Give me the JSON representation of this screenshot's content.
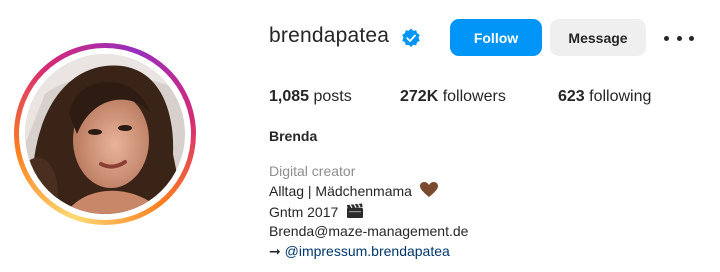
{
  "profile": {
    "username": "brendapatea",
    "verified": true,
    "full_name": "Brenda",
    "category": "Digital creator",
    "follow_label": "Follow",
    "message_label": "Message",
    "more_icon": "more-options-icon"
  },
  "stats": {
    "posts_count": "1,085",
    "posts_label": " posts",
    "followers_count": "272K",
    "followers_label": " followers",
    "following_count": "623",
    "following_label": " following"
  },
  "bio": {
    "line1": "Alltag | Mädchenmama",
    "line1_icon": "brown-heart-icon",
    "line2": "Gntm 2017",
    "line2_icon": "clapperboard-icon",
    "line3": "Brenda@maze-management.de",
    "line4_arrow": "➞",
    "line4_link": "@impressum.brendapatea"
  },
  "colors": {
    "accent": "#0095f6",
    "link": "#00376b",
    "secondary_text": "#8e8e8e"
  }
}
